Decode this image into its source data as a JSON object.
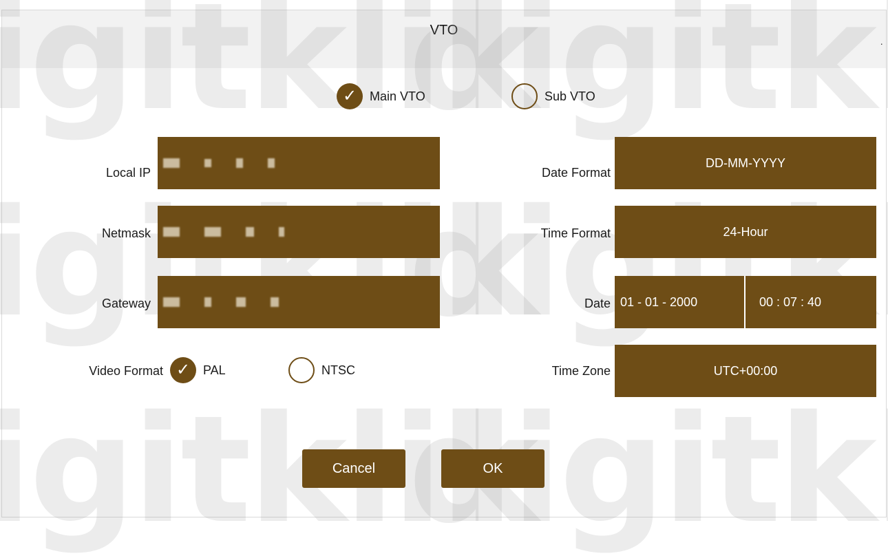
{
  "dialog": {
    "title": "VTO"
  },
  "watermark": {
    "text_left": "igitklik",
    "text_right": "digitklik"
  },
  "vto_type": {
    "options": [
      {
        "label": "Main VTO",
        "checked": true
      },
      {
        "label": "Sub VTO",
        "checked": false
      }
    ]
  },
  "network": {
    "local_ip_label": "Local IP",
    "netmask_label": "Netmask",
    "gateway_label": "Gateway"
  },
  "video_format": {
    "label": "Video Format",
    "options": [
      {
        "label": "PAL",
        "checked": true
      },
      {
        "label": "NTSC",
        "checked": false
      }
    ]
  },
  "datetime": {
    "date_format_label": "Date Format",
    "date_format_value": "DD-MM-YYYY",
    "time_format_label": "Time Format",
    "time_format_value": "24-Hour",
    "date_label": "Date",
    "date_value": "01 - 01 - 2000",
    "time_value": "00 : 07 : 40",
    "time_zone_label": "Time Zone",
    "time_zone_value": "UTC+00:00"
  },
  "buttons": {
    "cancel": "Cancel",
    "ok": "OK"
  },
  "colors": {
    "accent": "#6e4d16",
    "titlebar": "#f2f2f2"
  },
  "icons": {
    "checked": "check-icon",
    "radio": "radio-circle-icon"
  }
}
